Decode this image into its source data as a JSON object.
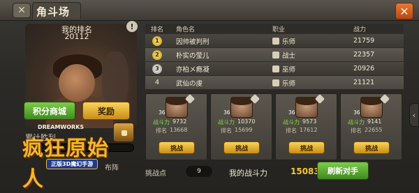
{
  "header": {
    "title": "角斗场",
    "close_glyph": "✕",
    "menu_glyph": "✕"
  },
  "left": {
    "my_rank_label": "我的排名",
    "my_rank_value": "20112",
    "info_glyph": "!",
    "shop_label": "积分商城",
    "reward_label": "奖励",
    "cumulative_wins_label": "累计胜利",
    "logo_brand": "DREAMWORKS",
    "logo_title": "疯狂原始人",
    "logo_subtitle": "正版3D魔幻手游",
    "bottom_label": "布阵"
  },
  "table": {
    "headers": [
      "排名",
      "角色名",
      "职业",
      "战力"
    ],
    "rows": [
      {
        "rank": "1",
        "medal": "gold",
        "name": "因帅被判刑",
        "job": "乐师",
        "power": "21759"
      },
      {
        "rank": "2",
        "medal": "silver",
        "name": "朴实の莹儿",
        "job": "战士",
        "power": "22357"
      },
      {
        "rank": "3",
        "medal": "bronze",
        "name": "亦柏メ瘾凝",
        "job": "巫师",
        "power": "20926"
      },
      {
        "rank": "4",
        "medal": "",
        "name": "武仙の虔",
        "job": "乐师",
        "power": "21121"
      }
    ]
  },
  "opponents": [
    {
      "level": "36",
      "power_label": "战斗力",
      "power": "9732",
      "rank_label": "排名",
      "rank": "13668",
      "button": "挑战"
    },
    {
      "level": "36",
      "power_label": "战斗力",
      "power": "10370",
      "rank_label": "排名",
      "rank": "15699",
      "button": "挑战"
    },
    {
      "level": "36",
      "power_label": "战斗力",
      "power": "9573",
      "rank_label": "排名",
      "rank": "17612",
      "button": "挑战"
    },
    {
      "level": "36",
      "power_label": "战斗力",
      "power": "9141",
      "rank_label": "排名",
      "rank": "22655",
      "button": "挑战"
    }
  ],
  "footer": {
    "challenge_points_label": "挑战点",
    "challenge_points_value": "9",
    "my_power_label": "我的战斗力",
    "my_power_value": "15083",
    "refresh_label": "刷新对手"
  },
  "side_arrow_glyph": "‹"
}
